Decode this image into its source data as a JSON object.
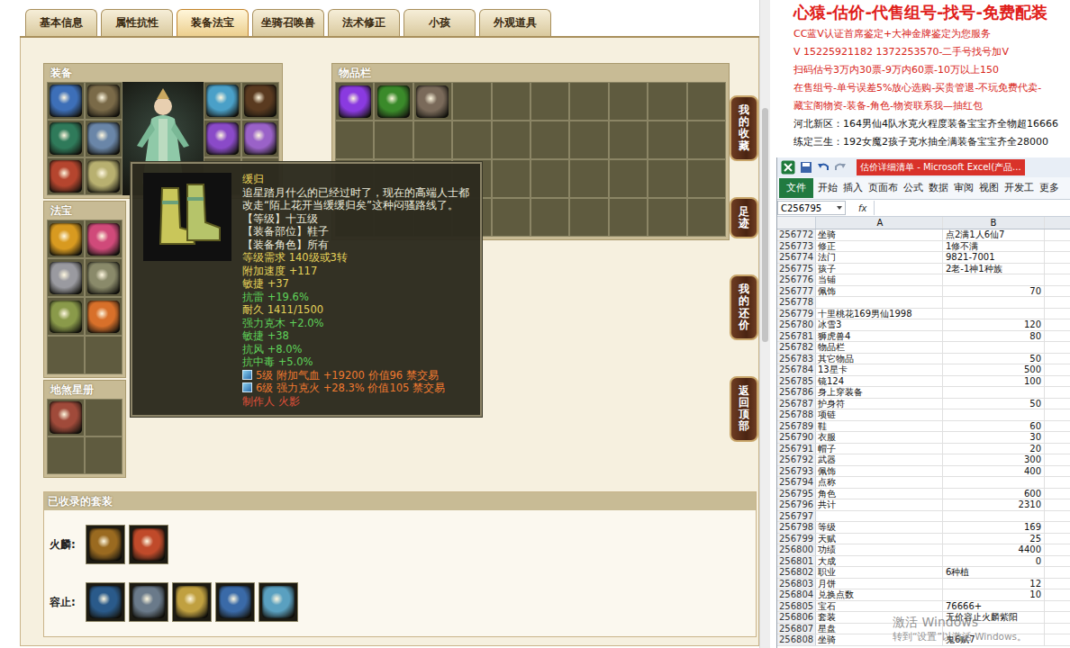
{
  "viewer": {
    "tabs": [
      {
        "label": "基本信息",
        "selected": false
      },
      {
        "label": "属性抗性",
        "selected": false
      },
      {
        "label": "装备法宝",
        "selected": true
      },
      {
        "label": "坐骑召唤兽",
        "selected": false
      },
      {
        "label": "法术修正",
        "selected": false
      },
      {
        "label": "小孩",
        "selected": false
      },
      {
        "label": "外观道具",
        "selected": false
      }
    ],
    "equipment": {
      "title": "装备",
      "left_slots": [
        {
          "filled": true,
          "color": "#3d6fb8"
        },
        {
          "filled": true,
          "color": "#7a6a48"
        },
        {
          "filled": true,
          "color": "#2f7a5a"
        },
        {
          "filled": true,
          "color": "#6a86a8"
        },
        {
          "filled": true,
          "color": "#b5452e"
        },
        {
          "filled": true,
          "color": "#b8b070"
        }
      ],
      "right_slots": [
        {
          "filled": true,
          "color": "#4aa0c8"
        },
        {
          "filled": true,
          "color": "#5a3a20"
        },
        {
          "filled": true,
          "color": "#8a4ac8"
        },
        {
          "filled": true,
          "color": "#9a62c8"
        },
        {
          "filled": false,
          "color": ""
        },
        {
          "filled": false,
          "color": ""
        }
      ]
    },
    "fabao": {
      "title": "法宝",
      "slots": [
        {
          "filled": true,
          "color": "#d89a20"
        },
        {
          "filled": true,
          "color": "#d04a7a"
        },
        {
          "filled": true,
          "color": "#9a9aa0"
        },
        {
          "filled": true,
          "color": "#8a8a6a"
        },
        {
          "filled": true,
          "color": "#8a9a4a"
        },
        {
          "filled": true,
          "color": "#d8702a"
        },
        {
          "filled": false,
          "color": ""
        },
        {
          "filled": false,
          "color": ""
        }
      ]
    },
    "disha": {
      "title": "地煞星册",
      "slots": [
        {
          "filled": true,
          "color": "#a04a3a"
        },
        {
          "filled": false,
          "color": ""
        },
        {
          "filled": false,
          "color": ""
        },
        {
          "filled": false,
          "color": ""
        }
      ]
    },
    "inventory": {
      "title": "物品栏",
      "items": [
        {
          "color": "#8a3ae0"
        },
        {
          "color": "#3a8a2a"
        },
        {
          "color": "#7a6a5a"
        }
      ]
    },
    "rail": [
      {
        "label": "我的收藏"
      },
      {
        "label": "足迹"
      },
      {
        "label": "我的还价"
      },
      {
        "label": "返回顶部"
      }
    ],
    "suits": {
      "title": "已收录的套装",
      "rows": [
        {
          "name": "火麟:",
          "icons": [
            {
              "color": "#9a6a20"
            },
            {
              "color": "#c04a2a"
            }
          ]
        },
        {
          "name": "容止:",
          "icons": [
            {
              "color": "#2a5a8a"
            },
            {
              "color": "#6a7a8a"
            },
            {
              "color": "#c0a040"
            },
            {
              "color": "#3a6aa8"
            },
            {
              "color": "#5aa0c0"
            }
          ]
        }
      ]
    },
    "tooltip": {
      "name": "缓归",
      "lines": [
        {
          "text": "追星踏月什么的已经过时了，现在的高端人士都改走“陌上花开当缓缓归矣”这种闷骚路线了。",
          "color": "#ecebdc",
          "kind": "text"
        },
        {
          "text": "【等级】十五级",
          "color": "#ecebdc",
          "kind": "text"
        },
        {
          "text": "【装备部位】鞋子",
          "color": "#ecebdc",
          "kind": "text"
        },
        {
          "text": "【装备角色】所有",
          "color": "#ecebdc",
          "kind": "text"
        },
        {
          "text": "等级需求 140级或3转",
          "color": "#e6d35a",
          "kind": "text"
        },
        {
          "text": "附加速度 +117",
          "color": "#e6d35a",
          "kind": "text"
        },
        {
          "text": "敏捷 +37",
          "color": "#e6d35a",
          "kind": "text"
        },
        {
          "text": "抗雷 +19.6%",
          "color": "#5fd35a",
          "kind": "text"
        },
        {
          "text": "耐久 1411/1500",
          "color": "#e6d35a",
          "kind": "text"
        },
        {
          "text": "强力克木 +2.0%",
          "color": "#5fd35a",
          "kind": "text"
        },
        {
          "text": "敏捷 +38",
          "color": "#5fd35a",
          "kind": "text"
        },
        {
          "text": "抗风 +8.0%",
          "color": "#5fd35a",
          "kind": "text"
        },
        {
          "text": "抗中毒 +5.0%",
          "color": "#5fd35a",
          "kind": "text"
        },
        {
          "text": "5级 附加气血 +19200 价值96 禁交易",
          "color": "#f07a30",
          "kind": "gem"
        },
        {
          "text": "6级 强力克火 +28.3% 价值105 禁交易",
          "color": "#f07a30",
          "kind": "gem"
        },
        {
          "text": "制作人 火影",
          "color": "#e0503a",
          "kind": "text"
        }
      ]
    }
  },
  "ads": {
    "headline": "心猿-估价-代售组号-找号-免费配装",
    "lines": [
      {
        "text": "CC蓝V认证首席鉴定+大神金牌鉴定为您服务",
        "color": "#d82418"
      },
      {
        "text": "V 15225921182  1372253570-二手号找号加V",
        "color": "#d82418"
      },
      {
        "text": "扫码估号3万内30票-9万内60票-10万以上150",
        "color": "#d82418"
      },
      {
        "text": "在售组号-单号误差5%放心选购-买贵管退-不玩免费代卖-",
        "color": "#d82418"
      },
      {
        "text": "藏宝阁物资-装备-角色-物资联系我—抽红包",
        "color": "#d82418"
      },
      {
        "text": "河北新区：164男仙4队水克火程度装备宝宝齐全物超16666",
        "color": "#111111"
      },
      {
        "text": "练定三生：192女魔2孩子克水抽全满装备宝宝齐全28000",
        "color": "#111111"
      }
    ]
  },
  "excel": {
    "title": "估价详细清单 - Microsoft Excel(产品...",
    "ribbon_tabs": [
      {
        "label": "文件",
        "kind": "file"
      },
      {
        "label": "开始",
        "kind": "tab"
      },
      {
        "label": "插入",
        "kind": "tab"
      },
      {
        "label": "页面布",
        "kind": "tab"
      },
      {
        "label": "公式",
        "kind": "tab"
      },
      {
        "label": "数据",
        "kind": "tab"
      },
      {
        "label": "审阅",
        "kind": "tab"
      },
      {
        "label": "视图",
        "kind": "tab"
      },
      {
        "label": "开发工",
        "kind": "tab"
      },
      {
        "label": "更多",
        "kind": "tab"
      }
    ],
    "name_box": "C256795",
    "fx": "fx",
    "columns": [
      "A",
      "B"
    ],
    "rows": [
      {
        "n": "256772",
        "a": "坐骑",
        "b": "点2满1人6仙7",
        "numeric": false
      },
      {
        "n": "256773",
        "a": "修正",
        "b": "1修不满",
        "numeric": false
      },
      {
        "n": "256774",
        "a": "法门",
        "b": "9821-7001",
        "numeric": false
      },
      {
        "n": "256775",
        "a": "孩子",
        "b": "2老-1神1种族",
        "numeric": false
      },
      {
        "n": "256776",
        "a": "当铺",
        "b": "",
        "numeric": false
      },
      {
        "n": "256777",
        "a": "佩饰",
        "b": "70",
        "numeric": true
      },
      {
        "n": "256778",
        "a": "",
        "b": "",
        "numeric": false
      },
      {
        "n": "256779",
        "a": "十里桃花169男仙1998",
        "b": "",
        "numeric": false
      },
      {
        "n": "256780",
        "a": "冰雪3",
        "b": "120",
        "numeric": true
      },
      {
        "n": "256781",
        "a": "狮虎兽4",
        "b": "80",
        "numeric": true
      },
      {
        "n": "256782",
        "a": "物品栏",
        "b": "",
        "numeric": false
      },
      {
        "n": "256783",
        "a": "其它物品",
        "b": "50",
        "numeric": true
      },
      {
        "n": "256784",
        "a": "13星卡",
        "b": "500",
        "numeric": true
      },
      {
        "n": "256785",
        "a": "镜124",
        "b": "100",
        "numeric": true
      },
      {
        "n": "256786",
        "a": "身上穿装备",
        "b": "",
        "numeric": false
      },
      {
        "n": "256787",
        "a": "护身符",
        "b": "50",
        "numeric": true
      },
      {
        "n": "256788",
        "a": "项链",
        "b": "",
        "numeric": false
      },
      {
        "n": "256789",
        "a": "鞋",
        "b": "60",
        "numeric": true
      },
      {
        "n": "256790",
        "a": "衣服",
        "b": "30",
        "numeric": true
      },
      {
        "n": "256791",
        "a": "帽子",
        "b": "20",
        "numeric": true
      },
      {
        "n": "256792",
        "a": "武器",
        "b": "300",
        "numeric": true
      },
      {
        "n": "256793",
        "a": "佩饰",
        "b": "400",
        "numeric": true
      },
      {
        "n": "256794",
        "a": "点称",
        "b": "",
        "numeric": false
      },
      {
        "n": "256795",
        "a": "角色",
        "b": "600",
        "numeric": true
      },
      {
        "n": "256796",
        "a": "共计",
        "b": "2310",
        "numeric": true
      },
      {
        "n": "256797",
        "a": "",
        "b": "",
        "numeric": false
      },
      {
        "n": "256798",
        "a": "等级",
        "b": "169",
        "numeric": true
      },
      {
        "n": "256799",
        "a": "天赋",
        "b": "25",
        "numeric": true
      },
      {
        "n": "256800",
        "a": "功绩",
        "b": "4400",
        "numeric": true
      },
      {
        "n": "256801",
        "a": "大成",
        "b": "0",
        "numeric": true
      },
      {
        "n": "256802",
        "a": "职业",
        "b": "6种植",
        "numeric": false
      },
      {
        "n": "256803",
        "a": "月饼",
        "b": "12",
        "numeric": true
      },
      {
        "n": "256804",
        "a": "兑换点数",
        "b": "10",
        "numeric": true
      },
      {
        "n": "256805",
        "a": "宝石",
        "b": "76666+",
        "numeric": false
      },
      {
        "n": "256806",
        "a": "套装",
        "b": "无价容止火麟紫阳",
        "numeric": false
      },
      {
        "n": "256807",
        "a": "星盘",
        "b": "",
        "numeric": false
      },
      {
        "n": "256808",
        "a": "坐骑",
        "b": "鬼6赋7",
        "numeric": false
      }
    ]
  },
  "watermark": {
    "title": "激活 Windows",
    "hint": "转到“设置”以激活 Windows。"
  }
}
